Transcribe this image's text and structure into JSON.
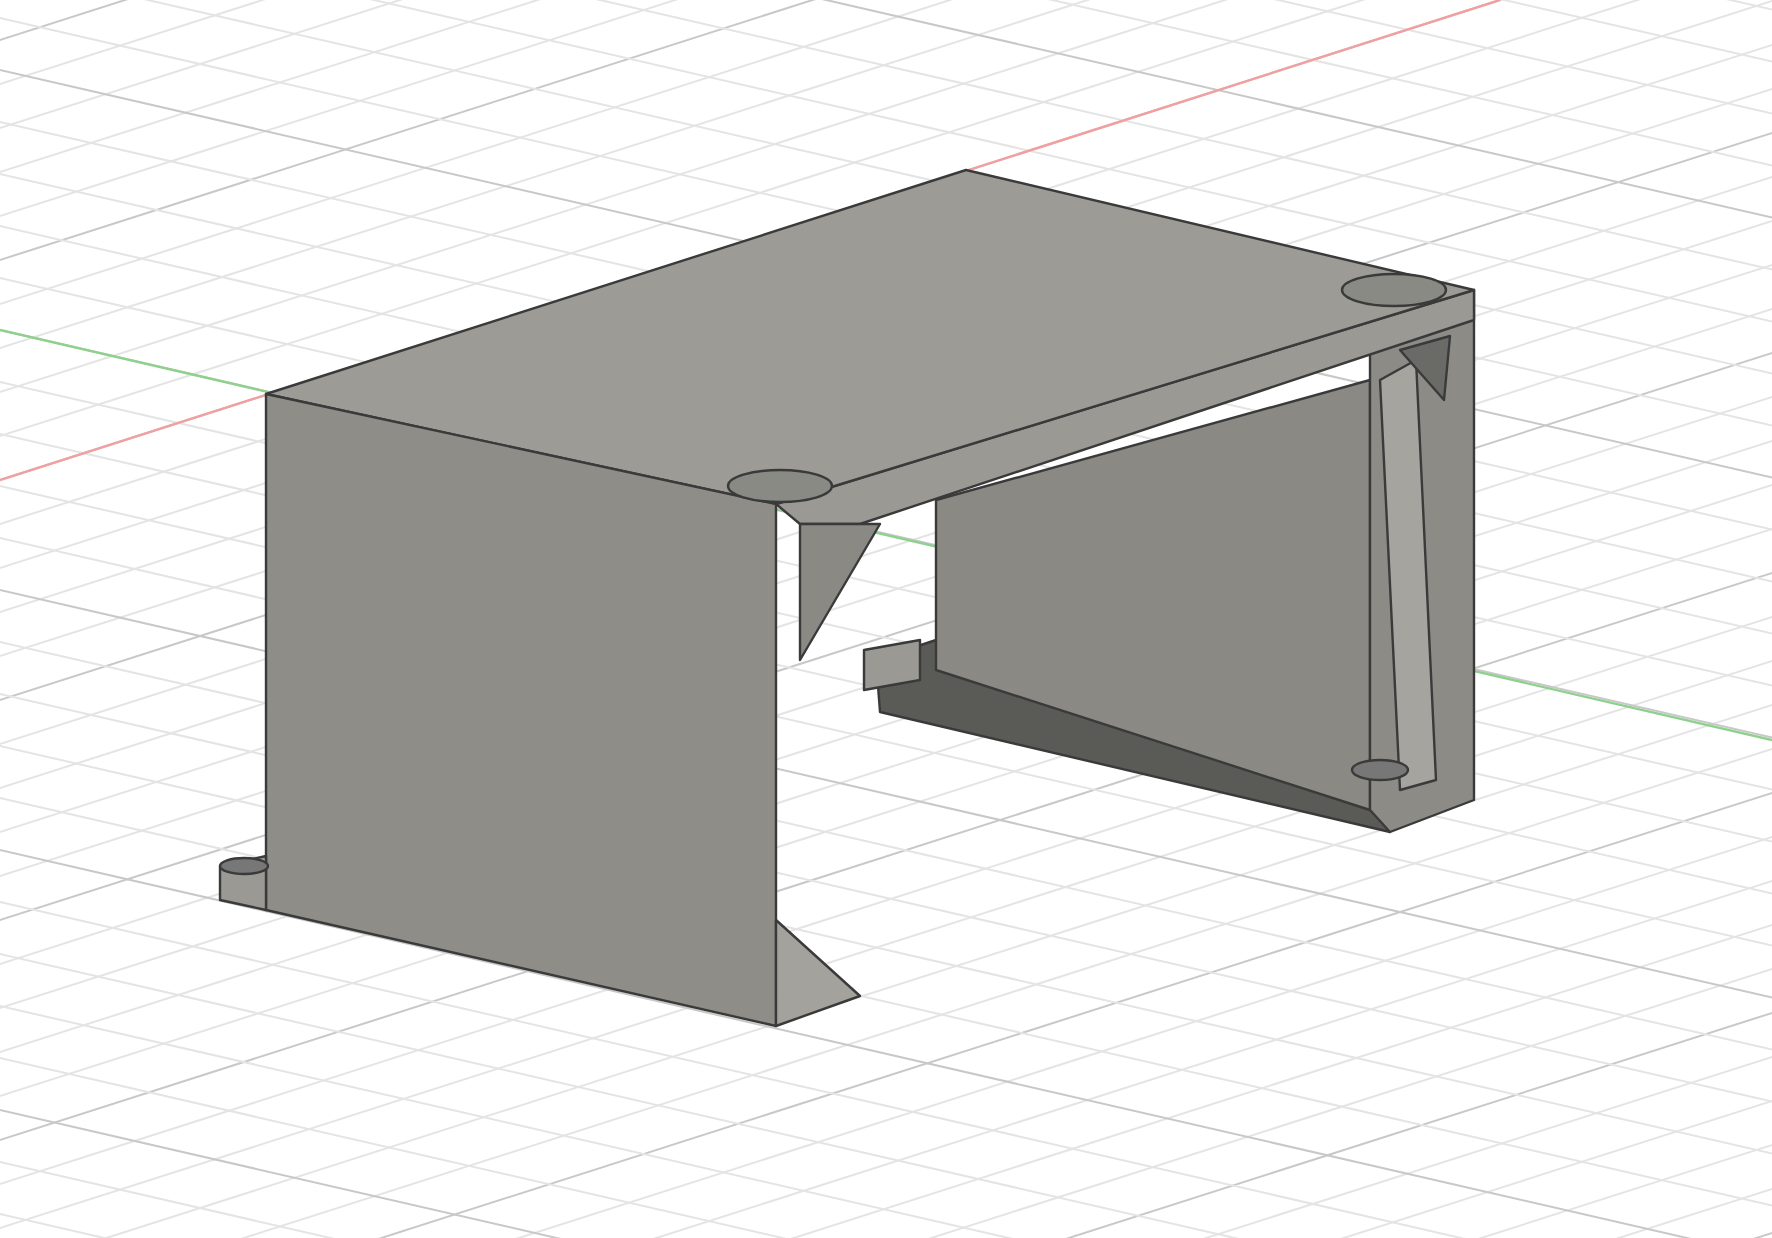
{
  "axes": [
    {
      "kind": "x",
      "color": "#f0a0a0"
    },
    {
      "kind": "y",
      "color": "#8fd08f"
    }
  ]
}
